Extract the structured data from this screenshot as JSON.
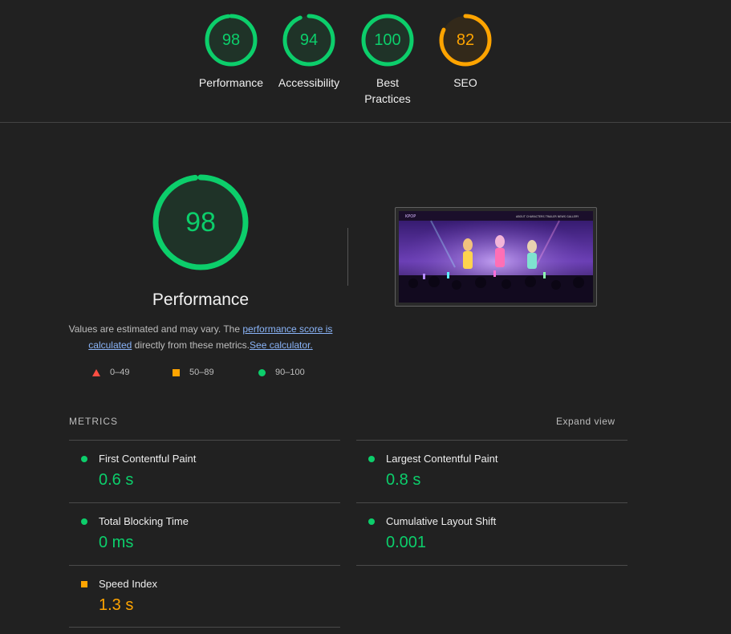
{
  "categories": [
    {
      "score": "98",
      "label": "Performance",
      "score_fraction": 0.98,
      "color": "#0cce6b"
    },
    {
      "score": "94",
      "label": "Accessibility",
      "score_fraction": 0.94,
      "color": "#0cce6b"
    },
    {
      "score": "100",
      "label": "Best Practices",
      "score_fraction": 1.0,
      "color": "#0cce6b"
    },
    {
      "score": "82",
      "label": "SEO",
      "score_fraction": 0.82,
      "color": "#ffa400"
    }
  ],
  "performance": {
    "score": "98",
    "score_fraction": 0.98,
    "title": "Performance",
    "desc_prefix": "Values are estimated and may vary. The ",
    "link_score": "performance score is calculated",
    "desc_middle": " directly from these metrics.",
    "link_calculator": "See calculator."
  },
  "legend": {
    "fail": "0–49",
    "average": "50–89",
    "pass": "90–100"
  },
  "screenshot": {
    "brand": "KPOP",
    "nav": "ABOUT CHARACTERS TRAILER NEWS GALLERY"
  },
  "metrics": {
    "heading": "METRICS",
    "expand_label": "Expand view",
    "items": [
      {
        "name": "First Contentful Paint",
        "value": "0.6 s",
        "status": "pass"
      },
      {
        "name": "Largest Contentful Paint",
        "value": "0.8 s",
        "status": "pass"
      },
      {
        "name": "Total Blocking Time",
        "value": "0 ms",
        "status": "pass"
      },
      {
        "name": "Cumulative Layout Shift",
        "value": "0.001",
        "status": "pass"
      },
      {
        "name": "Speed Index",
        "value": "1.3 s",
        "status": "average"
      }
    ]
  },
  "colors": {
    "pass": "#0cce6b",
    "average": "#ffa400",
    "fail": "#ff4e42",
    "background": "#212121"
  }
}
